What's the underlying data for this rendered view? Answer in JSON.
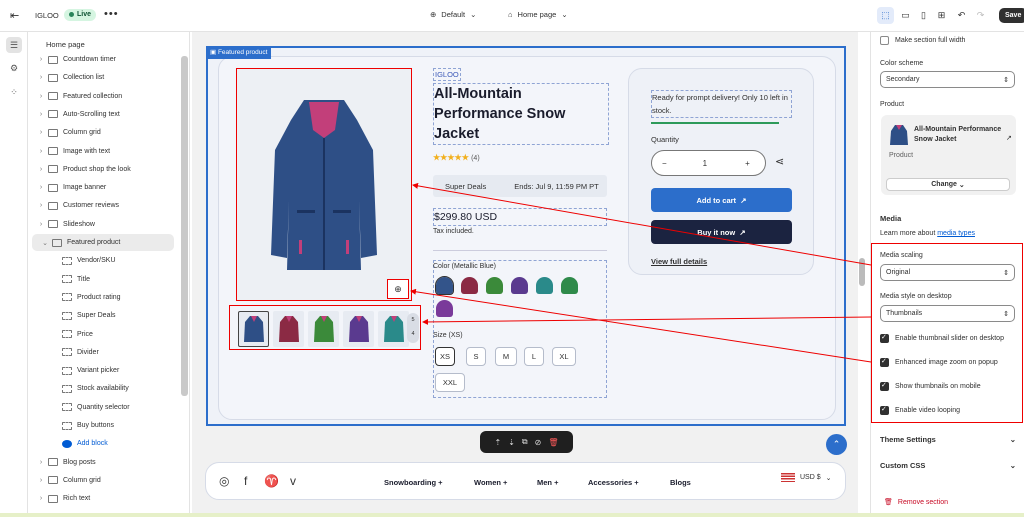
{
  "topbar": {
    "store_name": "IGLOO",
    "live_badge": "Live",
    "more": "•••",
    "theme": "Default",
    "page": "Home page",
    "save": "Save"
  },
  "sidebar": {
    "title": "Home page",
    "items": [
      {
        "label": "Countdown timer",
        "sub": false
      },
      {
        "label": "Collection list",
        "sub": false
      },
      {
        "label": "Featured collection",
        "sub": false
      },
      {
        "label": "Auto-Scrolling text",
        "sub": false
      },
      {
        "label": "Column grid",
        "sub": false
      },
      {
        "label": "Image with text",
        "sub": false
      },
      {
        "label": "Product shop the look",
        "sub": false
      },
      {
        "label": "Image banner",
        "sub": false
      },
      {
        "label": "Customer reviews",
        "sub": false
      },
      {
        "label": "Slideshow",
        "sub": false
      },
      {
        "label": "Featured product",
        "sub": false,
        "active": true
      },
      {
        "label": "Vendor/SKU",
        "sub": true
      },
      {
        "label": "Title",
        "sub": true
      },
      {
        "label": "Product rating",
        "sub": true
      },
      {
        "label": "Super Deals",
        "sub": true
      },
      {
        "label": "Price",
        "sub": true
      },
      {
        "label": "Divider",
        "sub": true
      },
      {
        "label": "Variant picker",
        "sub": true
      },
      {
        "label": "Stock availability",
        "sub": true
      },
      {
        "label": "Quantity selector",
        "sub": true
      },
      {
        "label": "Buy buttons",
        "sub": true
      },
      {
        "label": "Add block",
        "sub": true,
        "add": true
      },
      {
        "label": "Blog posts",
        "sub": false
      },
      {
        "label": "Column grid",
        "sub": false
      },
      {
        "label": "Rich text",
        "sub": false
      }
    ]
  },
  "preview": {
    "section_tag": "Featured product",
    "vendor": "IGLOO",
    "title": "All-Mountain Performance Snow Jacket",
    "stars": "★★★★★",
    "review_count": "(4)",
    "deal_label": "Super Deals",
    "deal_ends": "Ends: Jul 9, 11:59 PM PT",
    "price": "$299.80 USD",
    "tax": "Tax included.",
    "color_label": "Color (Metallic Blue)",
    "size_label": "Size (XS)",
    "sizes": [
      "XS",
      "S",
      "M",
      "L",
      "XL",
      "XXL"
    ],
    "stock": "Ready for prompt delivery! Only 10 left in stock.",
    "quantity_label": "Quantity",
    "quantity": "1",
    "add_to_cart": "Add to cart",
    "buy_now": "Buy it now",
    "view_details": "View full details",
    "thumb_count_a": "5",
    "thumb_count_b": "4",
    "swatches": [
      "#33548a",
      "#8b2a44",
      "#3b8a3a",
      "#5a3a8f",
      "#2a8a8a",
      "#2f8a4a",
      "#7a3a9a"
    ]
  },
  "footer": {
    "nav": [
      "Snowboarding",
      "Women",
      "Men",
      "Accessories",
      "Blogs"
    ],
    "currency": "USD $"
  },
  "right_panel": {
    "full_width": "Make section full width",
    "color_scheme_label": "Color scheme",
    "color_scheme_value": "Secondary",
    "product_label": "Product",
    "product_name": "All-Mountain Performance Snow Jacket",
    "product_type": "Product",
    "change": "Change",
    "media_heading": "Media",
    "media_learn": "Learn more about",
    "media_link": "media types",
    "scaling_label": "Media scaling",
    "scaling_value": "Original",
    "style_label": "Media style on desktop",
    "style_value": "Thumbnails",
    "checks": [
      {
        "label": "Enable thumbnail slider on desktop",
        "on": true
      },
      {
        "label": "Enhanced image zoom on popup",
        "on": true
      },
      {
        "label": "Show thumbnails on mobile",
        "on": true
      },
      {
        "label": "Enable video looping",
        "on": true
      }
    ],
    "theme_settings": "Theme Settings",
    "custom_css": "Custom CSS",
    "remove": "Remove section"
  }
}
